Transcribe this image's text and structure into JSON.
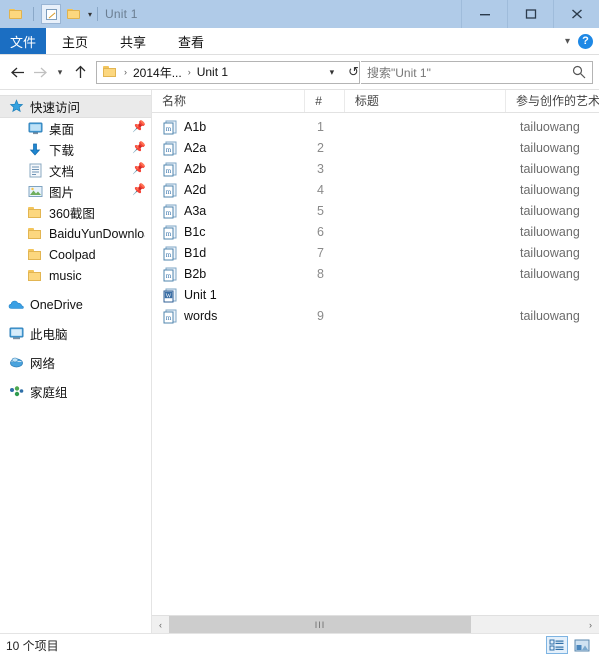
{
  "window": {
    "title": "Unit 1",
    "quick_access_toolbar": [
      {
        "name": "folder-icon",
        "label": ""
      },
      {
        "name": "properties-icon",
        "label": ""
      },
      {
        "name": "new-folder-icon",
        "label": ""
      },
      {
        "name": "customize-caret-icon",
        "label": "▾"
      }
    ],
    "controls": {
      "minimize": "—",
      "maximize": "□",
      "close": "✕"
    }
  },
  "ribbon": {
    "file_tab": "文件",
    "tabs": [
      "主页",
      "共享",
      "查看"
    ],
    "collapse_caret": "⌵",
    "help": "?"
  },
  "navbar": {
    "back": "←",
    "forward": "→",
    "recent": "⌵",
    "up": "↑",
    "breadcrumb": [
      "2014年...",
      "Unit 1"
    ],
    "breadcrumb_sep": "›",
    "address_caret": "⌵",
    "refresh": "↻",
    "search_placeholder": "搜索\"Unit 1\""
  },
  "sidebar": {
    "items": [
      {
        "label": "快速访问",
        "icon": "star-icon",
        "level": "root",
        "selected": true,
        "pinned": false
      },
      {
        "label": "桌面",
        "icon": "desktop-icon",
        "level": "child",
        "selected": false,
        "pinned": true
      },
      {
        "label": "下载",
        "icon": "download-icon",
        "level": "child",
        "selected": false,
        "pinned": true
      },
      {
        "label": "文档",
        "icon": "documents-icon",
        "level": "child",
        "selected": false,
        "pinned": true
      },
      {
        "label": "图片",
        "icon": "pictures-icon",
        "level": "child",
        "selected": false,
        "pinned": true
      },
      {
        "label": "360截图",
        "icon": "folder-icon",
        "level": "child",
        "selected": false,
        "pinned": false
      },
      {
        "label": "BaiduYunDownloa",
        "icon": "folder-icon",
        "level": "child",
        "selected": false,
        "pinned": false
      },
      {
        "label": "Coolpad",
        "icon": "folder-icon",
        "level": "child",
        "selected": false,
        "pinned": false
      },
      {
        "label": "music",
        "icon": "folder-icon",
        "level": "child",
        "selected": false,
        "pinned": false
      },
      {
        "label": "OneDrive",
        "icon": "onedrive-icon",
        "level": "root",
        "selected": false,
        "pinned": false
      },
      {
        "label": "此电脑",
        "icon": "this-pc-icon",
        "level": "root",
        "selected": false,
        "pinned": false
      },
      {
        "label": "网络",
        "icon": "network-icon",
        "level": "root",
        "selected": false,
        "pinned": false
      },
      {
        "label": "家庭组",
        "icon": "homegroup-icon",
        "level": "root",
        "selected": false,
        "pinned": false
      }
    ]
  },
  "filelist": {
    "columns": [
      {
        "label": "名称",
        "key": "name",
        "sorted": "asc"
      },
      {
        "label": "#",
        "key": "num"
      },
      {
        "label": "标题",
        "key": "title"
      },
      {
        "label": "参与创作的艺术",
        "key": "artist"
      }
    ],
    "rows": [
      {
        "name": "A1b",
        "num": "1",
        "title": "",
        "artist": "tailuowang",
        "icon": "media-file-icon"
      },
      {
        "name": "A2a",
        "num": "2",
        "title": "",
        "artist": "tailuowang",
        "icon": "media-file-icon"
      },
      {
        "name": "A2b",
        "num": "3",
        "title": "",
        "artist": "tailuowang",
        "icon": "media-file-icon"
      },
      {
        "name": "A2d",
        "num": "4",
        "title": "",
        "artist": "tailuowang",
        "icon": "media-file-icon"
      },
      {
        "name": "A3a",
        "num": "5",
        "title": "",
        "artist": "tailuowang",
        "icon": "media-file-icon"
      },
      {
        "name": "B1c",
        "num": "6",
        "title": "",
        "artist": "tailuowang",
        "icon": "media-file-icon"
      },
      {
        "name": "B1d",
        "num": "7",
        "title": "",
        "artist": "tailuowang",
        "icon": "media-file-icon"
      },
      {
        "name": "B2b",
        "num": "8",
        "title": "",
        "artist": "tailuowang",
        "icon": "media-file-icon"
      },
      {
        "name": "Unit 1",
        "num": "",
        "title": "",
        "artist": "",
        "icon": "word-file-icon"
      },
      {
        "name": "words",
        "num": "9",
        "title": "",
        "artist": "tailuowang",
        "icon": "media-file-icon"
      }
    ]
  },
  "scrollbar": {
    "left_arrow": "‹",
    "right_arrow": "›",
    "grip": "III"
  },
  "statusbar": {
    "item_count": "10 个项目",
    "view_details": "details-view",
    "view_large_icons": "large-icons-view"
  },
  "colors": {
    "titlebar": "#b0cbe8",
    "file_tab": "#1b6ec2",
    "accent": "#1e88e5",
    "selected_row": "#eaeaea"
  }
}
